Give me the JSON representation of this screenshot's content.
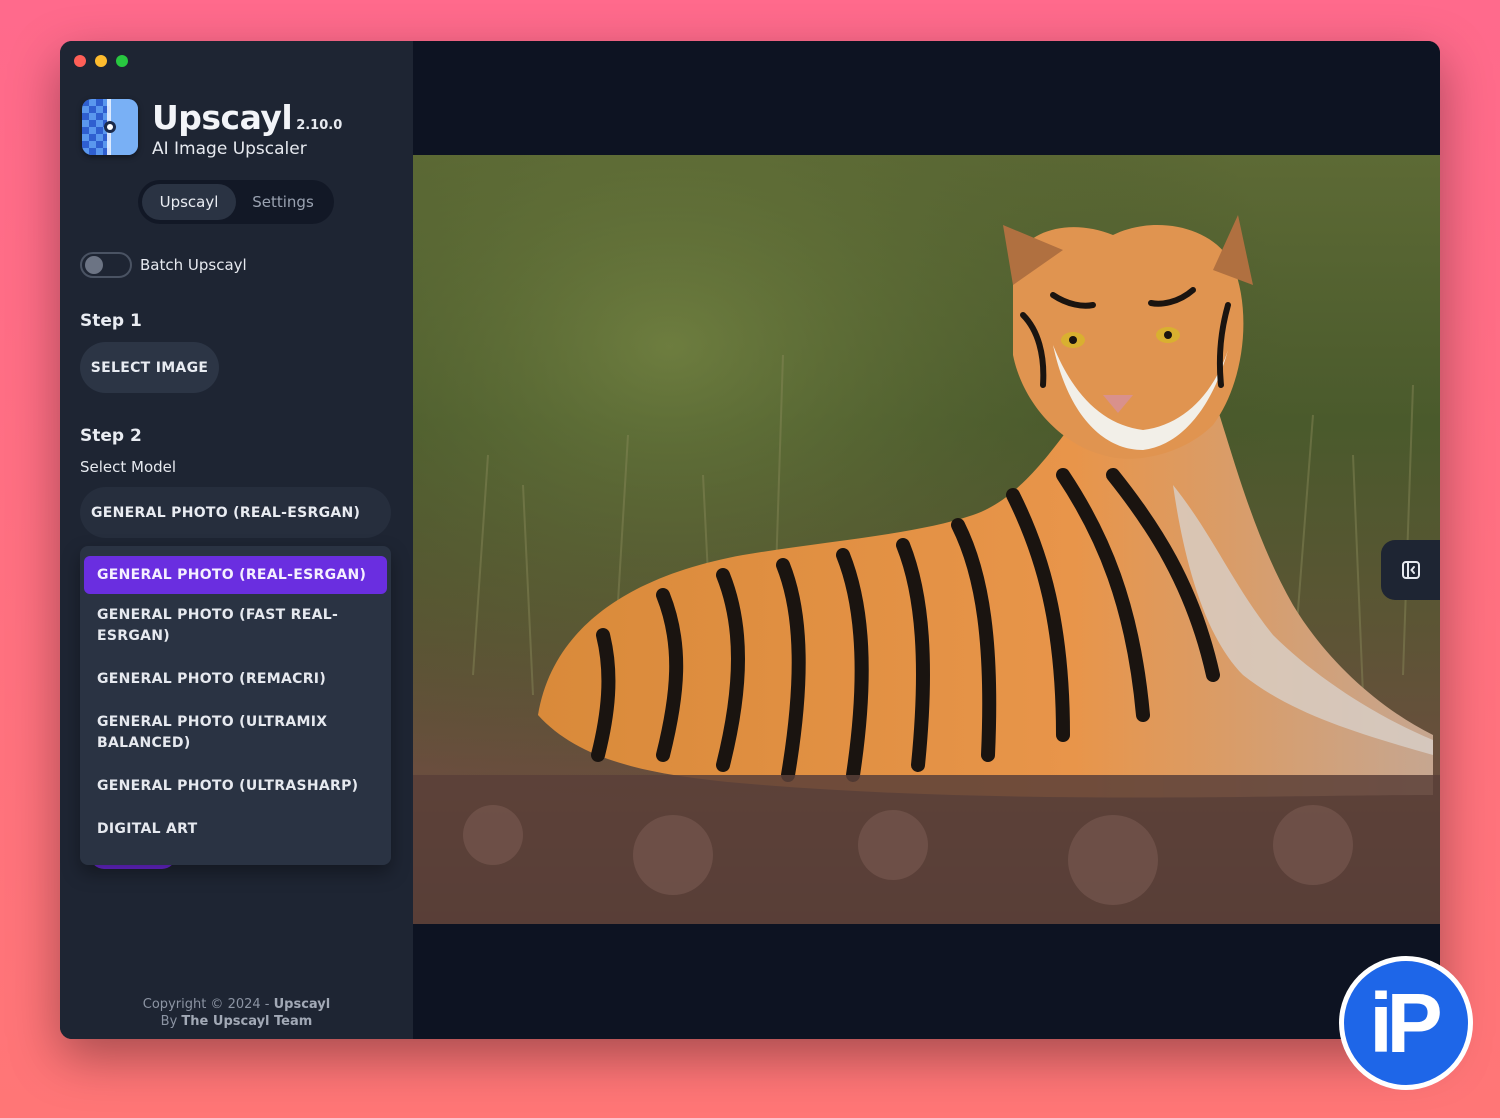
{
  "app": {
    "name": "Upscayl",
    "version": "2.10.0",
    "subtitle": "AI Image Upscaler"
  },
  "tabs": [
    {
      "label": "Upscayl",
      "active": true
    },
    {
      "label": "Settings",
      "active": false
    }
  ],
  "batch": {
    "label": "Batch Upscayl",
    "enabled": false
  },
  "step1": {
    "title": "Step 1",
    "button": "SELECT IMAGE"
  },
  "step2": {
    "title": "Step 2",
    "label": "Select Model",
    "selected": "GENERAL PHOTO (REAL-ESRGAN)",
    "options": [
      "GENERAL PHOTO (REAL-ESRGAN)",
      "GENERAL PHOTO (FAST REAL-ESRGAN)",
      "GENERAL PHOTO (REMACRI)",
      "GENERAL PHOTO (ULTRAMIX BALANCED)",
      "GENERAL PHOTO (ULTRASHARP)",
      "DIGITAL ART"
    ]
  },
  "footer": {
    "copyright_prefix": "Copyright © 2024 - ",
    "copyright_brand": "Upscayl",
    "by_prefix": "By ",
    "by_team": "The Upscayl Team"
  },
  "preview": {
    "image": "tiger-photo"
  },
  "watermark": {
    "text": "iP"
  },
  "colors": {
    "accent": "#6a2ee0",
    "sidebar": "#1e2533",
    "background": "#0d1322"
  }
}
